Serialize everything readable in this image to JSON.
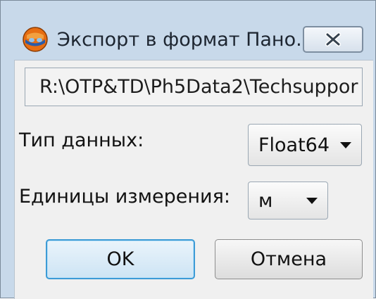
{
  "window": {
    "title": "Экспорт в формат Пано...",
    "app_icon": "globe-icon",
    "close_icon": "close-icon"
  },
  "path_field": {
    "value": "R:\\OTP&TD\\Ph5Data2\\Techsuppor"
  },
  "data_type": {
    "label": "Тип данных:",
    "selected": "Float64"
  },
  "units": {
    "label": "Единицы измерения:",
    "selected": "м"
  },
  "buttons": {
    "ok": "OK",
    "cancel": "Отмена"
  },
  "colors": {
    "title_bar": "#c8d9ea",
    "ok_border": "#3c9bd6"
  }
}
